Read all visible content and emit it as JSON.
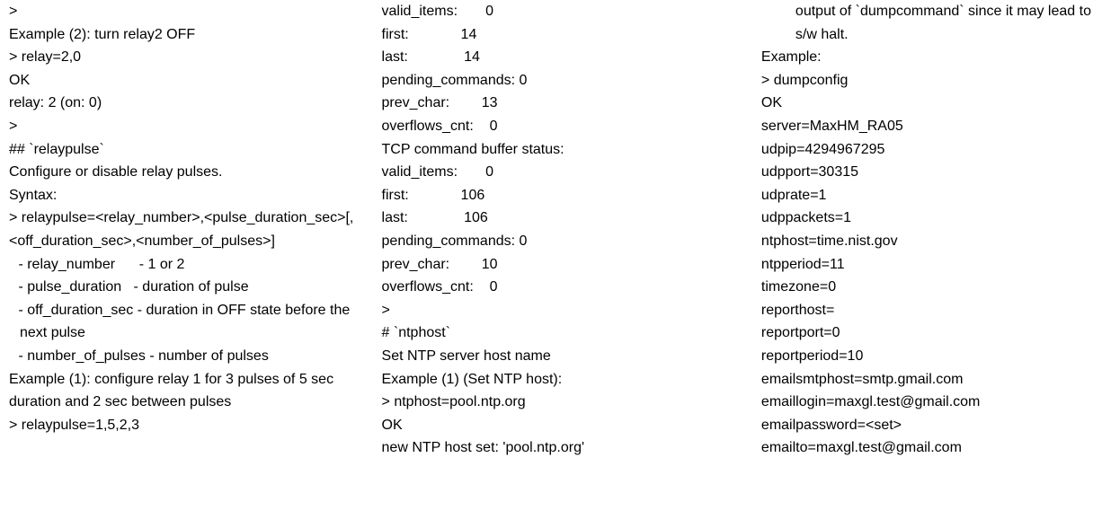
{
  "col1": {
    "l0": ">",
    "l1": "Example (2): turn relay2 OFF",
    "l2": "> relay=2,0",
    "l3": "OK",
    "l4": "relay: 2 (on: 0)",
    "l5": ">",
    "l6": "## `relaypulse`",
    "l7": "Configure or disable relay pulses.",
    "l8": "Syntax:",
    "l9": "> relaypulse=<relay_number>,<pulse_duration_sec>[,<off_duration_sec>,<number_of_pulses>]",
    "l10": " - relay_number      - 1 or 2",
    "l11": " - pulse_duration   - duration of pulse",
    "l12": " - off_duration_sec - duration in OFF state before the next pulse",
    "l13": " - number_of_pulses - number of pulses",
    "l14": "Example (1): configure relay 1 for 3 pulses of 5 sec duration and 2 sec between pulses",
    "l15": "> relaypulse=1,5,2,3"
  },
  "col2": {
    "l0": "valid_items:       0",
    "l1": "first:             14",
    "l2": "last:              14",
    "l3": "pending_commands: 0",
    "l4": "prev_char:        13",
    "l5": "overflows_cnt:    0",
    "l6": "TCP command buffer status:",
    "l7": "valid_items:       0",
    "l8": "first:             106",
    "l9": "last:              106",
    "l10": "pending_commands: 0",
    "l11": "prev_char:        10",
    "l12": "overflows_cnt:    0",
    "l13": ">",
    "l14": "# `ntphost`",
    "l15": "Set NTP server host name",
    "l16": "Example (1) (Set NTP host):",
    "l17": "> ntphost=pool.ntp.org",
    "l18": "OK",
    "l19": "new NTP host set: 'pool.ntp.org'"
  },
  "col3": {
    "l0": "output of `dumpcommand` since it may lead to s/w halt.",
    "l1": "Example:",
    "l2": "> dumpconfig",
    "l3": "OK",
    "l4": "server=MaxHM_RA05",
    "l5": "udpip=4294967295",
    "l6": "udpport=30315",
    "l7": "udprate=1",
    "l8": "udppackets=1",
    "l9": "ntphost=time.nist.gov",
    "l10": "ntpperiod=11",
    "l11": "timezone=0",
    "l12": "reporthost=",
    "l13": "reportport=0",
    "l14": "reportperiod=10",
    "l15": "emailsmtphost=smtp.gmail.com",
    "l16": "emaillogin=maxgl.test@gmail.com",
    "l17": "emailpassword=<set>",
    "l18": "emailto=maxgl.test@gmail.com"
  }
}
